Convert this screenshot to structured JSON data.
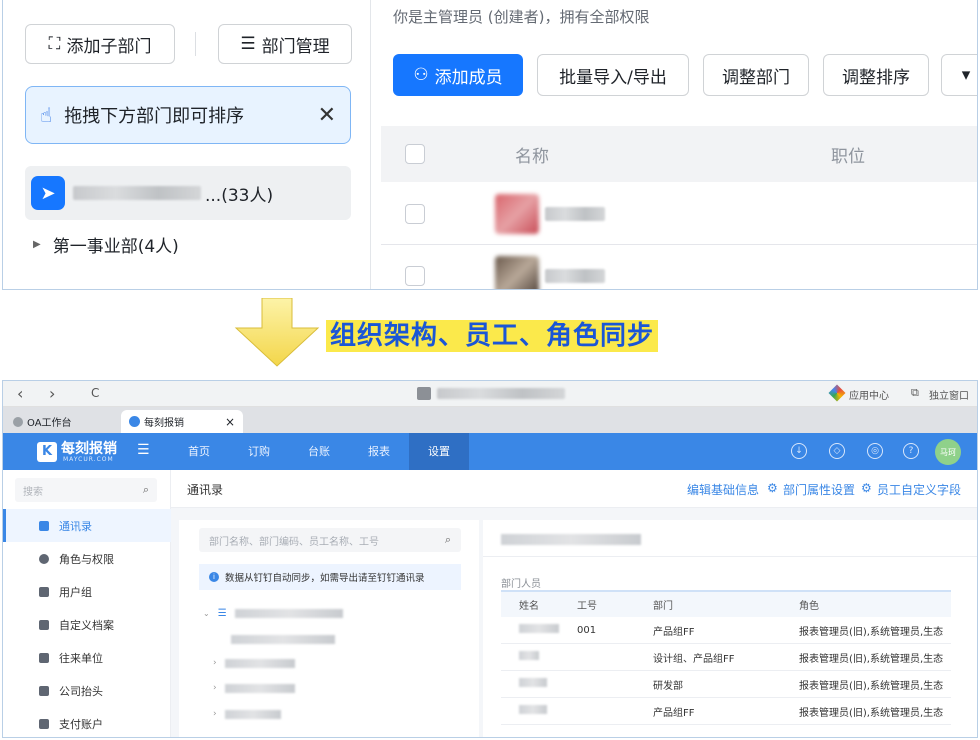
{
  "top": {
    "add_sub_dept": "添加子部门",
    "dept_manage": "部门管理",
    "drag_tip": "拖拽下方部门即可排序",
    "org_count": "...(33人)",
    "sub_dept": "第一事业部(4人)",
    "admin_note": "你是主管理员 (创建者)，拥有全部权限",
    "add_member": "添加成员",
    "import_export": "批量导入/导出",
    "adjust_dept": "调整部门",
    "adjust_order": "调整排序",
    "more": "▾",
    "col_name": "名称",
    "col_title": "职位"
  },
  "caption": "组织架构、员工、角色同步",
  "bottom": {
    "nav_back": "‹",
    "nav_forward": "›",
    "reload": "C",
    "app_center": "应用中心",
    "standalone": "独立窗口",
    "tabs": [
      "OA工作台",
      "每刻报销"
    ],
    "tab_close": "×",
    "brand": "每刻报销",
    "brand_sub": "MAYCUR.COM",
    "nav": [
      "首页",
      "订购",
      "台账",
      "报表",
      "设置"
    ],
    "user": "马珂",
    "side_search": "搜索",
    "side_items": [
      "通讯录",
      "角色与权限",
      "用户组",
      "自定义档案",
      "往来单位",
      "公司抬头",
      "支付账户"
    ],
    "page_title": "通讯录",
    "links": [
      "编辑基础信息",
      "部门属性设置",
      "员工自定义字段"
    ],
    "tree_search": "部门名称、部门编码、员工名称、工号",
    "sync_note": "数据从钉钉自动同步，如需导出请至钉钉通讯录",
    "section": "部门人员",
    "table_head": [
      "姓名",
      "工号",
      "部门",
      "角色"
    ],
    "rows": [
      {
        "id": "001",
        "dept": "产品组FF",
        "role": "报表管理员(旧),系统管理员,生态"
      },
      {
        "id": "",
        "dept": "设计组、产品组FF",
        "role": "报表管理员(旧),系统管理员,生态"
      },
      {
        "id": "",
        "dept": "研发部",
        "role": "报表管理员(旧),系统管理员,生态"
      },
      {
        "id": "",
        "dept": "产品组FF",
        "role": "报表管理员(旧),系统管理员,生态"
      }
    ]
  },
  "colors": {
    "primary": "#1677ff",
    "maycur_blue": "#3a87e6",
    "caption_bg": "#fbe94b"
  }
}
